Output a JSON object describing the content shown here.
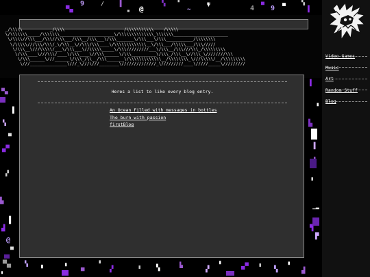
{
  "header": {
    "ascii_title_lines": [
      " _/\\\\\\\\\\           _/\\\\\\\\                        /\\\\\\\\\\\\\\\\\\\\\\    /\\\\\\\\\\",
      " \\/\\\\\\\\\\\\\\_____/\\\\\\\\\\\\\\______________________\\/\\\\\\\\\\\\\\\\\\\\\\\\\\\\_\\\\\\\\\\\\\\______________________",
      "  \\/\\\\\\\\//\\\\\\___/\\\\\\//\\\\\\___/\\\\\\__/\\\\\\___\\/\\\\\\_______\\/\\\\\\___\\/\\\\\\___________/\\\\\\\\\\\\\\\\",
      "   \\/\\\\\\\\\\///\\\\\\/\\\\\\/_\\/\\\\\\__\\//\\\\\\/\\\\\\____\\/\\\\\\\\\\\\\\\\\\\\\\\\\\__\\/\\\\\\___/\\\\\\\\\\___/\\\\\\/////",
      "    \\/\\\\\\__\\///\\\\\\\\\\/___\\/\\\\\\___\\//\\\\\\\\\\_____\\/\\\\\\/////////___\\/\\\\\\__/\\\\\\///\\\\\\_/\\\\\\\\\\\\\\\\\\",
      "     \\/\\\\\\____\\///\\\\\\/____\\/\\\\\\____\\//\\\\\\______\\/\\\\\\__________\\/\\\\\\_/\\\\\\__\\//\\\\\\_\\////////\\\\\\",
      "      \\/\\\\\\______\\///______\\/\\\\\\_/\\\\__/\\\\\\_______\\/\\\\\\\\\\\\\\\\\\\\\\\\\\__/\\\\\\\\\\\\\\\\_\\///\\\\\\\\\\/__/\\\\\\\\\\\\\\\\\\",
      "       \\///_______________\\///_\\///\\///________\\//////////////_\\/////////____\\/////_____\\/////////"
    ]
  },
  "main": {
    "intro": "Heres a list to like every blog entry.",
    "entries": [
      "An Ocean Filled with messages in bottles",
      "The burn with passion",
      "firstBlog"
    ]
  },
  "sidebar": {
    "logo_icon": "spiky-creature-logo",
    "nav": [
      "Video Games",
      "Music",
      "Art",
      "Random Stuff",
      "Blog"
    ]
  },
  "colors": {
    "panel": "#2f2f2f",
    "background": "#000000",
    "accent_purple": "#8a2be2",
    "text": "#ffffff"
  }
}
